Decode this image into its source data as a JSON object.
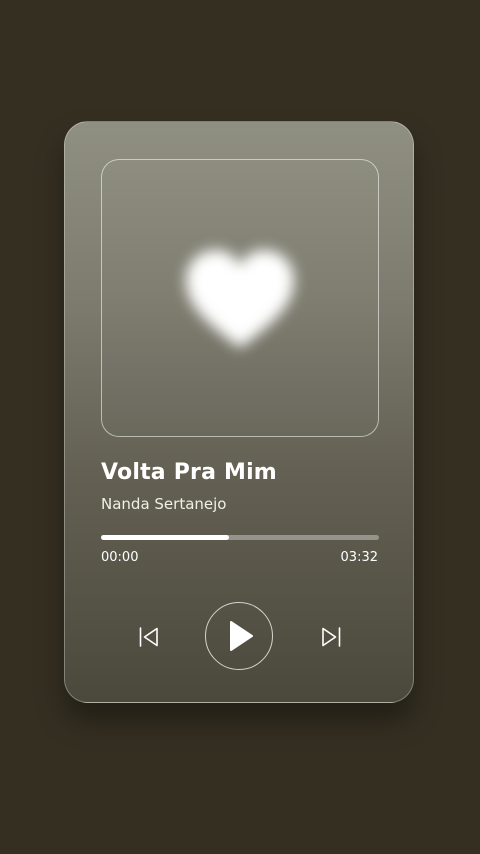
{
  "player": {
    "track_title": "Volta Pra Mim",
    "artist": "Nanda Sertanejo",
    "elapsed": "00:00",
    "duration": "03:32",
    "progress_fraction": 0.46,
    "artwork_icon": "heart-icon",
    "controls": {
      "previous_icon": "skip-previous-icon",
      "play_icon": "play-icon",
      "next_icon": "skip-next-icon"
    }
  },
  "colors": {
    "background": "#352f22",
    "text": "#ffffff",
    "progress_fill": "#ffffff"
  }
}
